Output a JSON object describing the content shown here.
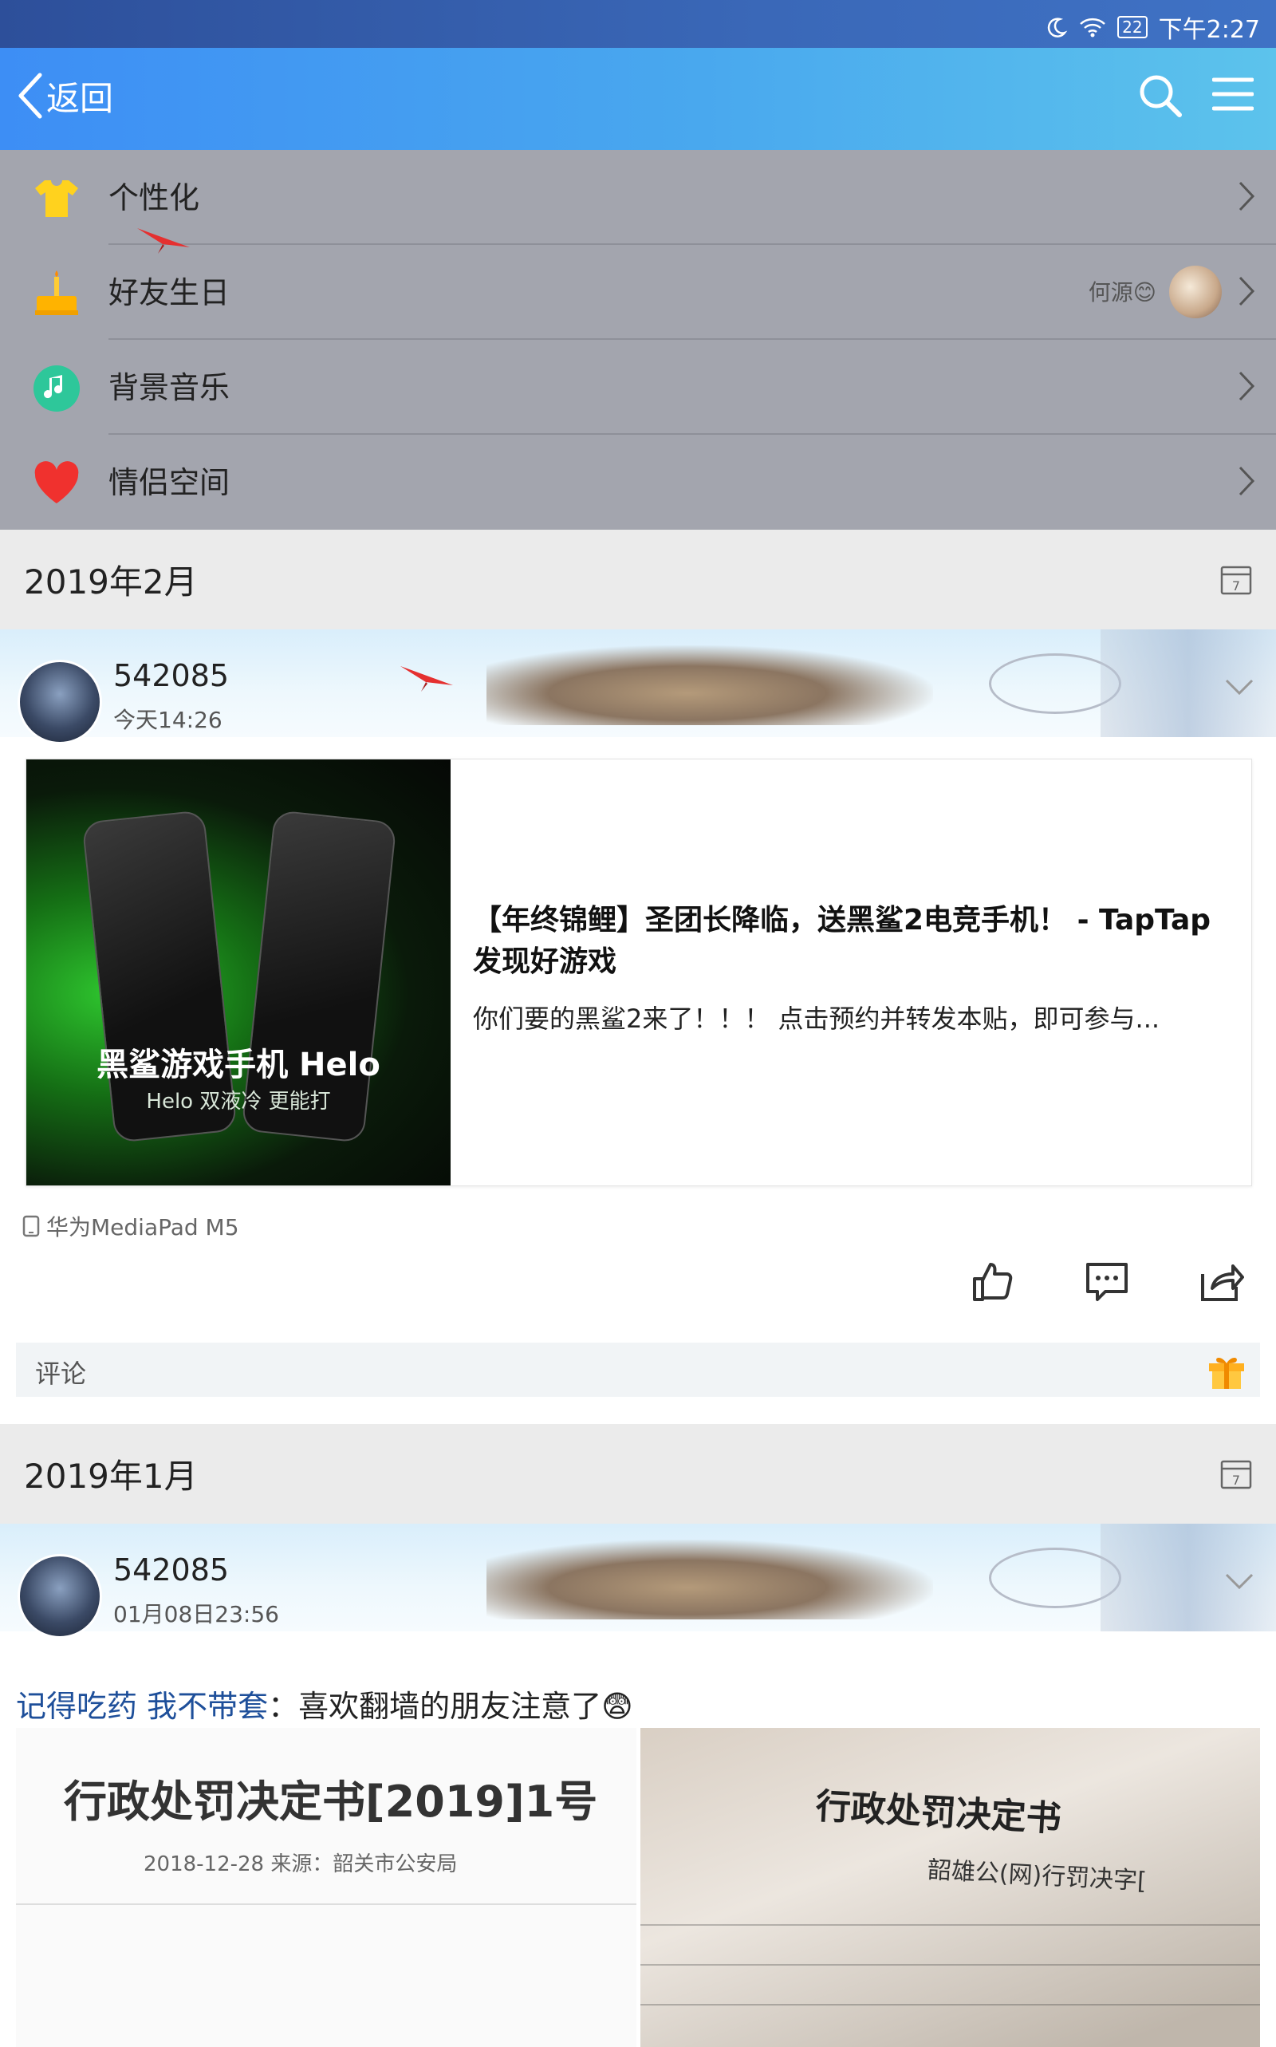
{
  "status_bar": {
    "battery": "22",
    "time": "下午2:27"
  },
  "header": {
    "back_label": "返回"
  },
  "menu": {
    "items": [
      {
        "label": "个性化"
      },
      {
        "label": "好友生日",
        "extra": "何源😊"
      },
      {
        "label": "背景音乐"
      },
      {
        "label": "情侣空间"
      }
    ]
  },
  "sections": [
    {
      "title": "2019年2月",
      "calendar_day": "7"
    },
    {
      "title": "2019年1月",
      "calendar_day": "7"
    }
  ],
  "posts": [
    {
      "username": "542085",
      "time": "今天14:26",
      "card": {
        "image_title": "黑鲨游戏手机 Helo",
        "image_subtitle": "Helo 双液冷 更能打",
        "title": "【年终锦鲤】圣团长降临，送黑鲨2电竞手机！ - TapTap 发现好游戏",
        "desc": "你们要的黑鲨2来了！！！ 点击预约并转发本贴，即可参与..."
      },
      "device": "华为MediaPad M5",
      "comment_placeholder": "评论"
    },
    {
      "username": "542085",
      "time": "01月08日23:56",
      "text_name": "记得吃药 我不带套",
      "text_body": "：喜欢翻墙的朋友注意了😨",
      "left_image": {
        "heading": "行政处罚决定书[2019]1号",
        "meta": "2018-12-28  来源：韶关市公安局"
      },
      "right_image": {
        "heading": "行政处罚决定书",
        "meta": "韶雄公(网)行罚决字["
      }
    }
  ],
  "colors": {
    "header_start": "#3d8ef5",
    "header_end": "#5cc3ec",
    "menu_bg": "#a3a5ae",
    "section_bg": "#ebebeb"
  }
}
